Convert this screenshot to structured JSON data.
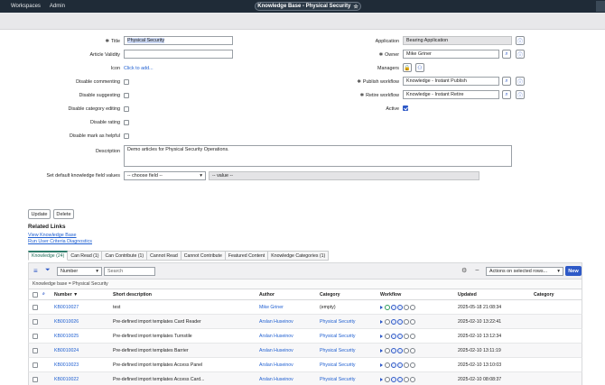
{
  "topbar": {
    "nav": [
      "Workspaces",
      "Admin"
    ],
    "title": "Knowledge Base - Physical Security",
    "star": "☆"
  },
  "form": {
    "left": [
      {
        "label": "Title",
        "required": true,
        "type": "text",
        "value": "Physical Security"
      },
      {
        "label": "Article Validity",
        "type": "text",
        "value": ""
      },
      {
        "label": "Icon",
        "type": "link",
        "value": "Click to add..."
      },
      {
        "label": "Disable commenting",
        "type": "checkbox"
      },
      {
        "label": "Disable suggesting",
        "type": "checkbox"
      },
      {
        "label": "Disable category editing",
        "type": "checkbox"
      },
      {
        "label": "Disable rating",
        "type": "checkbox"
      },
      {
        "label": "Disable mark as helpful",
        "type": "checkbox"
      }
    ],
    "right": {
      "application_label": "Application",
      "application_value": "Bearing Application",
      "owner_label": "Owner",
      "owner_value": "Mike Griner",
      "managers_label": "Managers",
      "publish_label": "Publish workflow",
      "publish_value": "Knowledge - Instant Publish",
      "retire_label": "Retire workflow",
      "retire_value": "Knowledge - Instant Retire",
      "active_label": "Active"
    },
    "description_label": "Description",
    "description_value": "Demo articles for Physical Security Operations.",
    "default_field_label": "Set default knowledge field values",
    "choose_field": "-- choose field --",
    "value_placeholder": "-- value --"
  },
  "actions": {
    "update": "Update",
    "delete": "Delete"
  },
  "related": {
    "title": "Related Links",
    "links": [
      "View Knowledge Base",
      "Run User Criteria Diagnostics"
    ]
  },
  "tabs": [
    "Knowledge (24)",
    "Can Read (1)",
    "Can Contribute (1)",
    "Cannot Read",
    "Cannot Contribute",
    "Featured Content",
    "Knowledge Categories (1)"
  ],
  "list": {
    "filter_field": "Number",
    "search_placeholder": "Search",
    "actions_select": "Actions on selected rows...",
    "new_label": "New",
    "filter_line": "Knowledge base = Physical Security",
    "columns": [
      "Number",
      "Short description",
      "Author",
      "Category",
      "Workflow",
      "Updated",
      "Category"
    ],
    "sort_indicator": "▼",
    "rows": [
      {
        "number": "KB0010027",
        "desc": "test",
        "author": "Mike Griner",
        "category": "(empty)",
        "updated": "2025-05-18 21:08:34",
        "wf_first_green": true
      },
      {
        "number": "KB0010026",
        "desc": "Pre-defined import templates Card Reader",
        "author": "Arslan Huseinov",
        "category": "Physical Security",
        "updated": "2025-02-10 13:22:41"
      },
      {
        "number": "KB0010025",
        "desc": "Pre-defined import templates Turnstile",
        "author": "Arslan Huseinov",
        "category": "Physical Security",
        "updated": "2025-02-10 13:12:34"
      },
      {
        "number": "KB0010024",
        "desc": "Pre-defined import templates Barrier",
        "author": "Arslan Huseinov",
        "category": "Physical Security",
        "updated": "2025-02-10 13:11:19"
      },
      {
        "number": "KB0010023",
        "desc": "Pre-defined import templates Access Panel",
        "author": "Arslan Huseinov",
        "category": "Physical Security",
        "updated": "2025-02-10 13:10:03"
      },
      {
        "number": "KB0010022",
        "desc": "Pre-defined import templates Access Card...",
        "author": "Arslan Huseinov",
        "category": "Physical Security",
        "updated": "2025-02-10 08:08:37"
      }
    ]
  },
  "colors": {
    "topbar": "#1f2b37",
    "accent": "#2e59c7",
    "link": "#1f5fd1",
    "tab_active": "#2e7d6b"
  }
}
